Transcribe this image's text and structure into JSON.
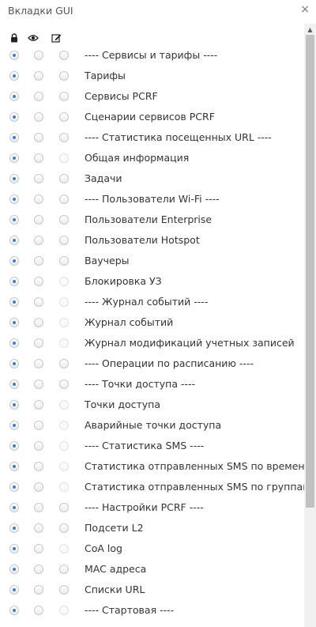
{
  "window": {
    "title": "Вкладки GUI",
    "close_icon": "×"
  },
  "header": {
    "icons": [
      "lock-icon",
      "eye-icon",
      "edit-icon"
    ]
  },
  "rows": [
    {
      "label": "---- Сервисы и тарифы ----",
      "state": 0,
      "third_enabled": true
    },
    {
      "label": "Тарифы",
      "state": 0,
      "third_enabled": true
    },
    {
      "label": "Сервисы PCRF",
      "state": 0,
      "third_enabled": true
    },
    {
      "label": "Сценарии сервисов PCRF",
      "state": 0,
      "third_enabled": true
    },
    {
      "label": "---- Статистика посещенных URL ----",
      "state": 0,
      "third_enabled": true
    },
    {
      "label": "Общая информация",
      "state": 0,
      "third_enabled": false
    },
    {
      "label": "Задачи",
      "state": 0,
      "third_enabled": true
    },
    {
      "label": "---- Пользователи Wi-Fi ----",
      "state": 0,
      "third_enabled": true
    },
    {
      "label": "Пользователи Enterprise",
      "state": 0,
      "third_enabled": true
    },
    {
      "label": "Пользователи Hotspot",
      "state": 0,
      "third_enabled": true
    },
    {
      "label": "Ваучеры",
      "state": 0,
      "third_enabled": true
    },
    {
      "label": "Блокировка УЗ",
      "state": 0,
      "third_enabled": false
    },
    {
      "label": "---- Журнал событий ----",
      "state": 0,
      "third_enabled": false
    },
    {
      "label": "Журнал событий",
      "state": 0,
      "third_enabled": false
    },
    {
      "label": "Журнал модификаций учетных записей",
      "state": 0,
      "third_enabled": false
    },
    {
      "label": "---- Операции по расписанию ----",
      "state": 0,
      "third_enabled": true
    },
    {
      "label": "---- Точки доступа ----",
      "state": 0,
      "third_enabled": true
    },
    {
      "label": "Точки доступа",
      "state": 0,
      "third_enabled": false
    },
    {
      "label": "Аварийные точки доступа",
      "state": 0,
      "third_enabled": false
    },
    {
      "label": "---- Статистика SMS ----",
      "state": 0,
      "third_enabled": false
    },
    {
      "label": "Статистика отправленных SMS по времени",
      "state": 0,
      "third_enabled": false
    },
    {
      "label": "Статистика отправленных SMS по группам",
      "state": 0,
      "third_enabled": false
    },
    {
      "label": "---- Настройки PCRF ----",
      "state": 0,
      "third_enabled": true
    },
    {
      "label": "Подсети L2",
      "state": 0,
      "third_enabled": true
    },
    {
      "label": "CoA log",
      "state": 0,
      "third_enabled": false
    },
    {
      "label": "MAC адреса",
      "state": 0,
      "third_enabled": true
    },
    {
      "label": "Списки URL",
      "state": 0,
      "third_enabled": true
    },
    {
      "label": "---- Стартовая ----",
      "state": 0,
      "third_enabled": false
    }
  ],
  "colors": {
    "accent": "#3a7fd5",
    "text": "#333333"
  }
}
